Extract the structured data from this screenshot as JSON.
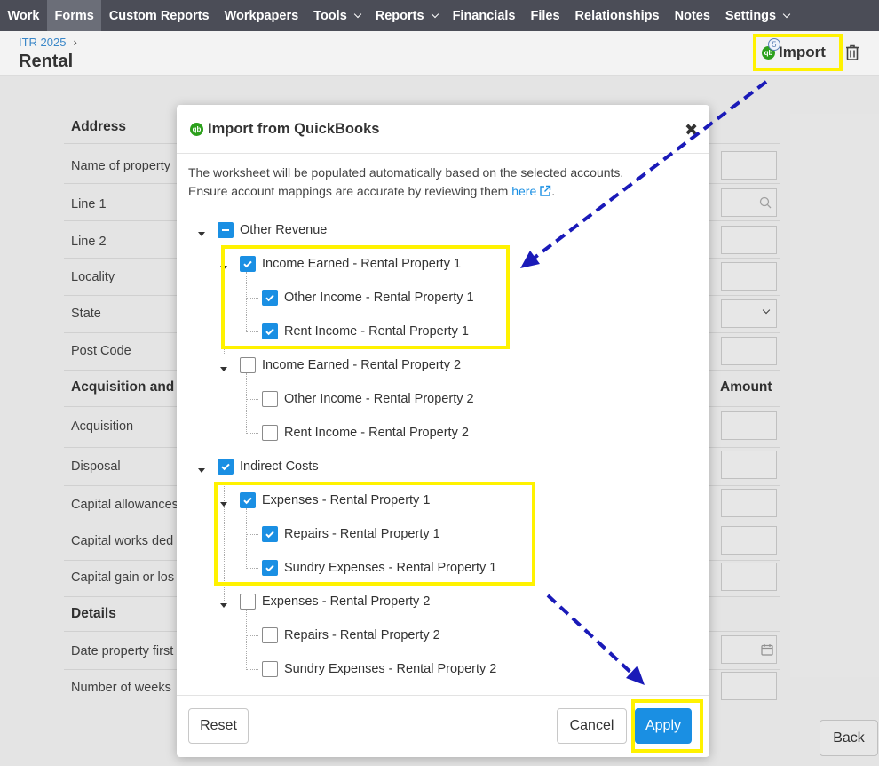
{
  "nav": {
    "items": [
      {
        "label": "Work",
        "dropdown": false,
        "active": false
      },
      {
        "label": "Forms",
        "dropdown": false,
        "active": true
      },
      {
        "label": "Custom Reports",
        "dropdown": false,
        "active": false
      },
      {
        "label": "Workpapers",
        "dropdown": false,
        "active": false
      },
      {
        "label": "Tools",
        "dropdown": true,
        "active": false
      },
      {
        "label": "Reports",
        "dropdown": true,
        "active": false
      },
      {
        "label": "Financials",
        "dropdown": false,
        "active": false
      },
      {
        "label": "Files",
        "dropdown": false,
        "active": false
      },
      {
        "label": "Relationships",
        "dropdown": false,
        "active": false
      },
      {
        "label": "Notes",
        "dropdown": false,
        "active": false
      },
      {
        "label": "Settings",
        "dropdown": true,
        "active": false
      }
    ]
  },
  "header": {
    "breadcrumb": "ITR 2025",
    "breadcrumb_sep": "›",
    "title": "Rental",
    "import_label": "Import",
    "import_badge": "5"
  },
  "form": {
    "section_address": "Address",
    "name_of_property": "Name of property",
    "line1": "Line 1",
    "line2": "Line 2",
    "locality": "Locality",
    "state": "State",
    "post_code": "Post Code",
    "section_acquisition": "Acquisition and",
    "amount_header": "Amount",
    "acquisition": "Acquisition",
    "disposal": "Disposal",
    "capital_allowances": "Capital allowances",
    "capital_works": "Capital works ded",
    "capital_gain": "Capital gain or los",
    "section_details": "Details",
    "date_property_first": "Date property first",
    "number_of_weeks": "Number of weeks",
    "back_label": "Back"
  },
  "modal": {
    "title": "Import from QuickBooks",
    "desc_line1": "The worksheet will be populated automatically based on the selected accounts.",
    "desc_line2": "Ensure account mappings are accurate by reviewing them",
    "desc_link": "here",
    "desc_end": ".",
    "tree": {
      "other_revenue": "Other Revenue",
      "income_earned_1": "Income Earned  -  Rental Property 1",
      "other_income_1": "Other Income  -  Rental Property 1",
      "rent_income_1": "Rent Income  -  Rental Property 1",
      "income_earned_2": "Income Earned  -  Rental Property 2",
      "other_income_2": "Other Income  -  Rental Property 2",
      "rent_income_2": "Rent Income  -  Rental Property 2",
      "indirect_costs": "Indirect Costs",
      "expenses_1": "Expenses  -  Rental Property 1",
      "repairs_1": "Repairs  -  Rental Property 1",
      "sundry_1": "Sundry Expenses  -  Rental Property 1",
      "expenses_2": "Expenses  -  Rental Property 2",
      "repairs_2": "Repairs  -  Rental Property 2",
      "sundry_2": "Sundry Expenses  -  Rental Property 2"
    },
    "reset_label": "Reset",
    "cancel_label": "Cancel",
    "apply_label": "Apply"
  },
  "colors": {
    "nav_bg": "#4b4d57",
    "accent": "#1a8fe3",
    "highlight": "#fff200",
    "arrow": "#1a1ab8",
    "qb_green": "#2ca01c"
  }
}
